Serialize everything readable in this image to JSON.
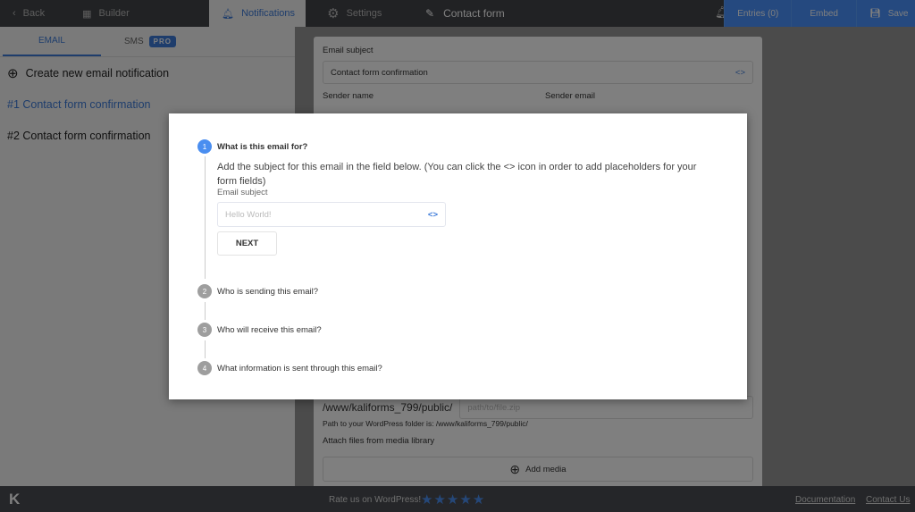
{
  "topbar": {
    "back": "Back",
    "builder": "Builder",
    "notifications": "Notifications",
    "settings": "Settings",
    "title": "Contact form",
    "entries": "Entries (0)",
    "embed": "Embed",
    "save": "Save"
  },
  "sidebar": {
    "tab_email": "EMAIL",
    "tab_sms": "SMS",
    "pro_badge": "PRO",
    "create": "Create new email notification",
    "items": [
      {
        "label": "#1 Contact form confirmation"
      },
      {
        "label": "#2 Contact form confirmation"
      }
    ]
  },
  "card": {
    "email_subject_label": "Email subject",
    "email_subject_value": "Contact form confirmation",
    "sender_name_label": "Sender name",
    "sender_email_label": "Sender email",
    "path_prefix": "/www/kaliforms_799/public/",
    "path_placeholder": "path/to/file.zip",
    "path_hint": "Path to your WordPress folder is: /www/kaliforms_799/public/",
    "attach_label": "Attach files from media library",
    "add_media": "Add media"
  },
  "modal": {
    "steps": [
      {
        "num": "1",
        "title": "What is this email for?"
      },
      {
        "num": "2",
        "title": "Who is sending this email?"
      },
      {
        "num": "3",
        "title": "Who will receive this email?"
      },
      {
        "num": "4",
        "title": "What information is sent through this email?"
      }
    ],
    "description": "Add the subject for this email in the field below. (You can click the <> icon in order to add placeholders for your form fields)",
    "field_label": "Email subject",
    "field_placeholder": "Hello World!",
    "next": "NEXT"
  },
  "footer": {
    "logo": "K",
    "rate": "Rate us on WordPress!",
    "stars": 5,
    "documentation": "Documentation",
    "contact": "Contact Us"
  },
  "colors": {
    "accent": "#4a8ef0",
    "star": "#4a8ef0"
  }
}
